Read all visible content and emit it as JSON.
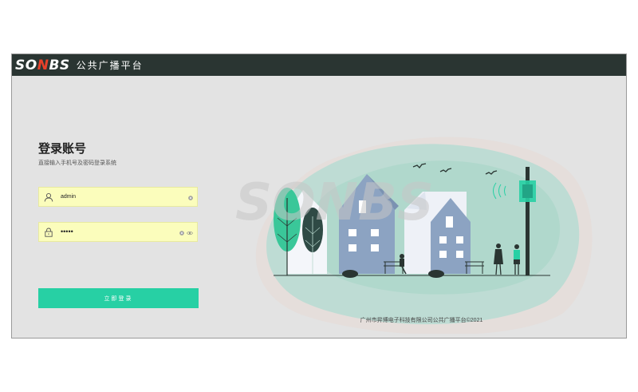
{
  "header": {
    "logo_text": "SONBS",
    "platform_name": "公共广播平台"
  },
  "login": {
    "title": "登录账号",
    "subtitle": "直接输入手机号及密码登录系统",
    "username_value": "admin",
    "password_value": "•••••",
    "submit_label": "立即登录"
  },
  "watermark": "SONBS",
  "footer": {
    "copyright": "广州市昇博电子科技有限公司公共广播平台©2021"
  },
  "colors": {
    "header_bg": "#2a3532",
    "accent": "#27d0a4",
    "field_bg": "#fbfdbc",
    "house_blue": "#8ca3c2"
  }
}
